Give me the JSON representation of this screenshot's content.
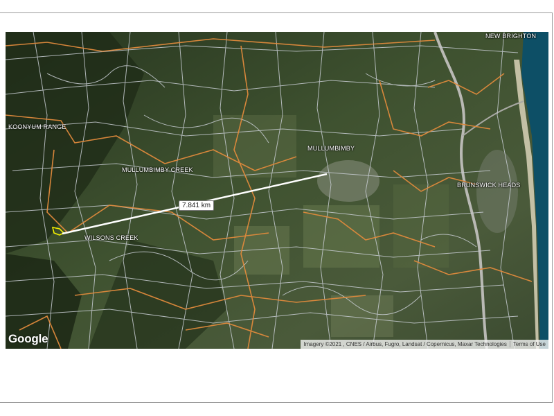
{
  "map": {
    "labels": {
      "new_brighton": "NEW BRIGHTON",
      "koonyum_range": "KOONYUM RANGE",
      "mullumbimby": "MULLUMBIMBY",
      "mullumbimby_creek": "MULLUMBIMBY CREEK",
      "brunswick_heads": "BRUNSWICK HEADS",
      "wilsons_creek": "WILSONS CREEK"
    },
    "measurement": "7.841 km",
    "logo": "Google",
    "attribution": "Imagery ©2021 , CNES / Airbus, Fugro, Landsat / Copernicus, Maxar Technologies",
    "terms": "Terms of Use",
    "colors": {
      "boundary": "#e08a3c",
      "parcel": "#c8cdd3",
      "measure_line": "#ffffff",
      "property_outline": "#f4f000",
      "ocean": "#0d4f66"
    }
  }
}
